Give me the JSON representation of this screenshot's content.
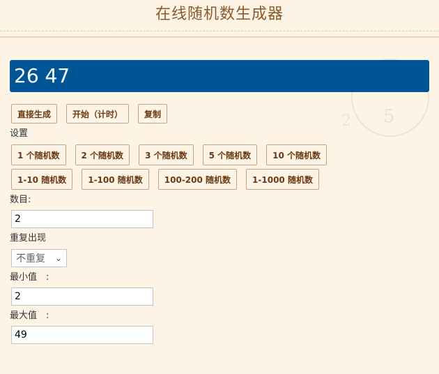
{
  "header": {
    "title": "在线随机数生成器"
  },
  "result": {
    "value": "26 47"
  },
  "actions": {
    "generate": "直接生成",
    "start_timer": "开始（计时）",
    "copy": "复制"
  },
  "settings_label": "设置",
  "presets_row1": [
    "1 个随机数",
    "2 个随机数",
    "3 个随机数",
    "5 个随机数",
    "10 个随机数"
  ],
  "presets_row2": [
    "1-10 随机数",
    "1-100 随机数",
    "100-200 随机数",
    "1-1000 随机数"
  ],
  "count": {
    "label": "数目:",
    "value": "2"
  },
  "repeat": {
    "label": "重复出现",
    "selected": "不重复"
  },
  "min": {
    "label": "最小值　:",
    "value": "2"
  },
  "max": {
    "label": "最大值　:",
    "value": "49"
  }
}
